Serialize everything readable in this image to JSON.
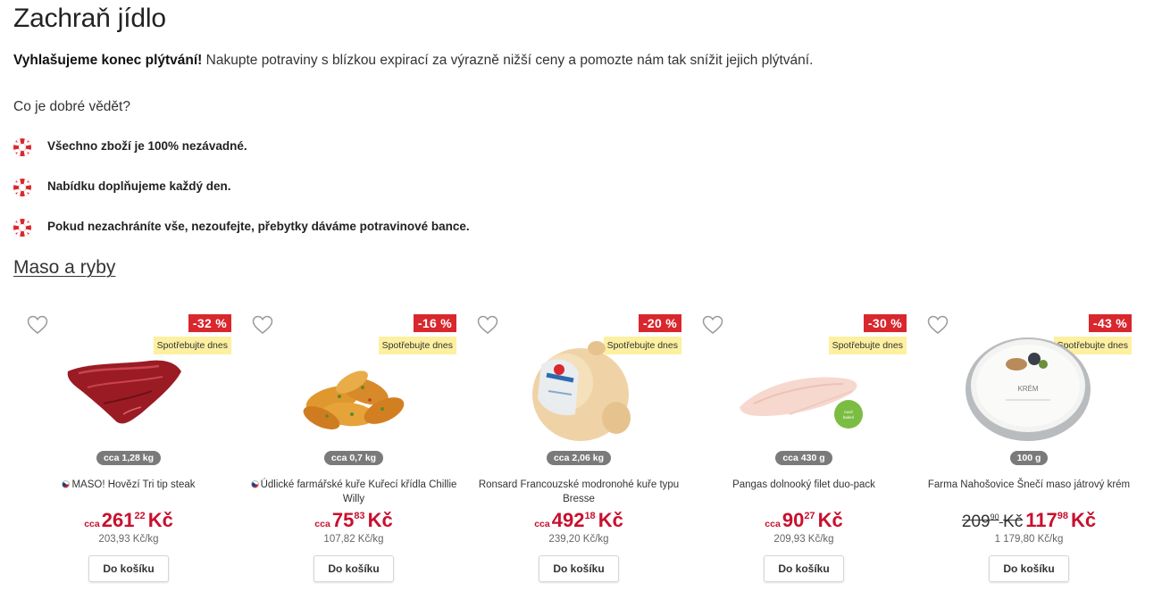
{
  "page": {
    "title": "Zachraň jídlo",
    "intro_bold": "Vyhlašujeme konec plýtvání!",
    "intro_text": " Nakupte potraviny s blízkou expirací za výrazně nižší ceny a pomozte nám tak snížit jejich plýtvání.",
    "info_heading": "Co je dobré vědět?",
    "info_items": [
      "Všechno zboží je 100% nezávadné.",
      "Nabídku doplňujeme každý den.",
      "Pokud nezachráníte vše, nezoufejte, přebytky dáváme potravinové bance."
    ],
    "section_title": "Maso a ryby"
  },
  "colors": {
    "discount": "#d9272e",
    "price": "#c8102e",
    "consume_badge": "#fdf0a0",
    "weight_badge": "#7a7a7a"
  },
  "products": [
    {
      "discount": "-32 %",
      "consume": "Spotřebujte dnes",
      "weight": "cca 1,28 kg",
      "name": "MASO! Hovězí Tri tip steak",
      "price_prefix": "cca",
      "price_int": "261",
      "price_dec": "22",
      "currency": "Kč",
      "unit_price": "203,93 Kč/kg",
      "cart": "Do košíku",
      "image": "beef-steak"
    },
    {
      "discount": "-16 %",
      "consume": "Spotřebujte dnes",
      "weight": "cca 0,7 kg",
      "name": "Údlické farmářské kuře Kuřecí křídla Chillie Willy",
      "price_prefix": "cca",
      "price_int": "75",
      "price_dec": "83",
      "currency": "Kč",
      "unit_price": "107,82 Kč/kg",
      "cart": "Do košíku",
      "image": "chicken-wings"
    },
    {
      "discount": "-20 %",
      "consume": "Spotřebujte dnes",
      "weight": "cca 2,06 kg",
      "name": "Ronsard Francouzské modronohé kuře typu Bresse",
      "price_prefix": "cca",
      "price_int": "492",
      "price_dec": "18",
      "currency": "Kč",
      "unit_price": "239,20 Kč/kg",
      "cart": "Do košíku",
      "image": "whole-chicken"
    },
    {
      "discount": "-30 %",
      "consume": "Spotřebujte dnes",
      "weight": "cca 430 g",
      "name": "Pangas dolnooký filet duo-pack",
      "price_prefix": "cca",
      "price_int": "90",
      "price_dec": "27",
      "currency": "Kč",
      "unit_price": "209,93 Kč/kg",
      "cart": "Do košíku",
      "image": "fish-fillet"
    },
    {
      "discount": "-43 %",
      "consume": "Spotřebujte dnes",
      "weight": "100 g",
      "name": "Farma Nahošovice Šnečí maso játrový krém",
      "old_int": "209",
      "old_dec": "90",
      "old_cur": "Kč",
      "price_int": "117",
      "price_dec": "98",
      "currency": "Kč",
      "unit_price": "1 179,80 Kč/kg",
      "cart": "Do košíku",
      "image": "cream-tin"
    }
  ]
}
